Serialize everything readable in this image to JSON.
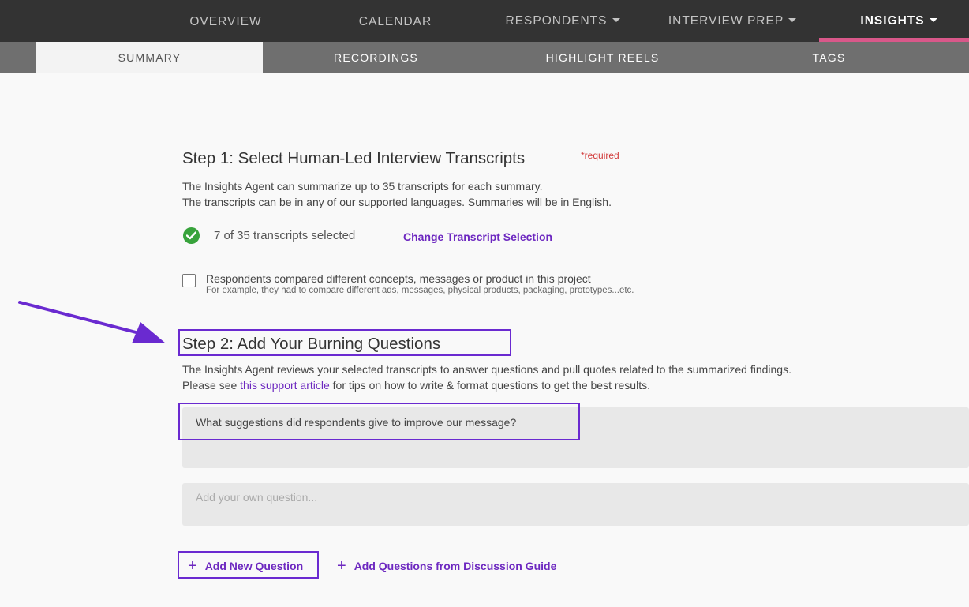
{
  "topnav": {
    "items": [
      {
        "label": "OVERVIEW"
      },
      {
        "label": "CALENDAR"
      },
      {
        "label": "RESPONDENTS"
      },
      {
        "label": "INTERVIEW PREP"
      },
      {
        "label": "INSIGHTS"
      }
    ]
  },
  "subnav": {
    "tabs": [
      {
        "label": "SUMMARY"
      },
      {
        "label": "RECORDINGS"
      },
      {
        "label": "HIGHLIGHT REELS"
      },
      {
        "label": "TAGS"
      }
    ]
  },
  "step1": {
    "title": "Step 1: Select Human-Led Interview Transcripts",
    "required": "*required",
    "desc1": "The Insights Agent can summarize up to 35 transcripts for each summary.",
    "desc2": "The transcripts can be in any of our supported languages. Summaries will be in English.",
    "status": "7 of 35 transcripts selected",
    "change_link": "Change Transcript Selection",
    "checkbox_label": "Respondents compared different concepts, messages or product in this project",
    "checkbox_hint": "For example, they had to compare different ads, messages, physical products, packaging, prototypes...etc."
  },
  "step2": {
    "title": "Step 2: Add Your Burning Questions",
    "desc1": "The Insights Agent reviews your selected transcripts to answer questions and pull quotes related to the summarized findings.",
    "desc2_prefix": "Please see ",
    "desc2_link": "this support article",
    "desc2_suffix": " for tips on how to write & format questions to get the best results.",
    "question1": "What suggestions did respondents give to improve our message?",
    "question_placeholder": "Add your own question...",
    "add_new": "Add New Question",
    "add_from_guide": "Add Questions from Discussion Guide"
  },
  "colors": {
    "accent": "#6d28c0",
    "highlight_border": "#6a2ad0",
    "active_underline": "#d9588a",
    "success": "#38a33c",
    "required": "#d23c3c"
  }
}
